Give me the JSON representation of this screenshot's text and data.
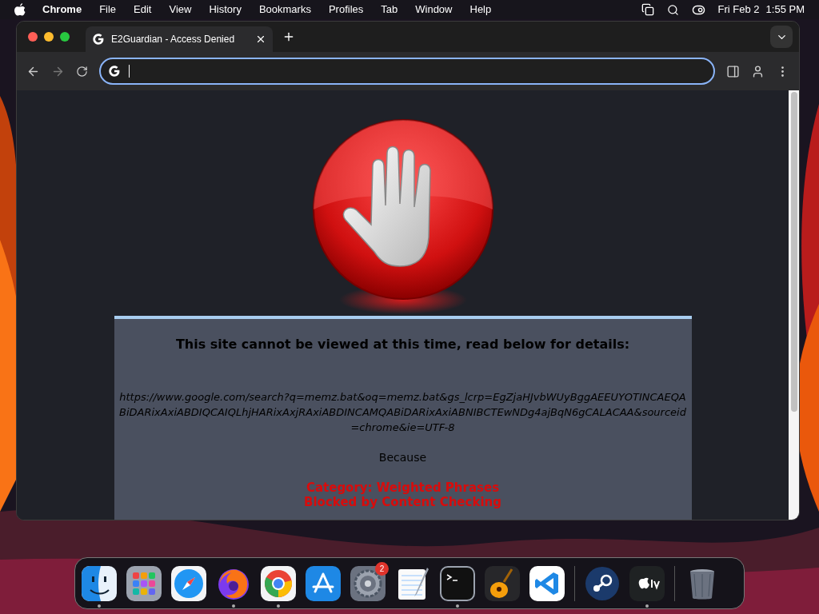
{
  "menu_bar": {
    "app_name": "Chrome",
    "menus": [
      "File",
      "Edit",
      "View",
      "History",
      "Bookmarks",
      "Profiles",
      "Tab",
      "Window",
      "Help"
    ],
    "date": "Fri Feb 2",
    "time": "1:55 PM"
  },
  "browser": {
    "tabs": [
      {
        "title": "E2Guardian - Access Denied",
        "selected": true
      }
    ],
    "page": {
      "heading": "This site cannot be viewed at this time, read below for details:",
      "url": "https://www.google.com/search?q=memz.bat&oq=memz.bat&gs_lcrp=EgZjaHJvbWUyBggAEEUYOTINCAEQABiDARixAxiABDIQCAIQLhjHARixAxjRAxiABDINCAMQABiDARixAxiABNIBCTEwNDg4ajBqN6gCALACAA&sourceid=chrome&ie=UTF-8",
      "because": "Because",
      "category": "Category: Weighted Phrases",
      "reason": "Blocked by Content Checking"
    }
  },
  "dock": {
    "items": [
      {
        "kind": "finder",
        "running": true
      },
      {
        "kind": "launchpad",
        "running": false
      },
      {
        "kind": "safari",
        "running": false
      },
      {
        "kind": "firefox",
        "running": true
      },
      {
        "kind": "chrome",
        "running": true
      },
      {
        "kind": "appstore",
        "running": false
      },
      {
        "kind": "settings",
        "running": false,
        "badge": "2"
      },
      {
        "kind": "textedit",
        "running": false
      },
      {
        "kind": "terminal",
        "running": true
      },
      {
        "kind": "guitar",
        "running": false
      },
      {
        "kind": "vscode",
        "running": false
      },
      {
        "kind": "separator"
      },
      {
        "kind": "steam",
        "running": false
      },
      {
        "kind": "tv",
        "running": true
      },
      {
        "kind": "separator"
      },
      {
        "kind": "trash",
        "running": false
      }
    ]
  }
}
